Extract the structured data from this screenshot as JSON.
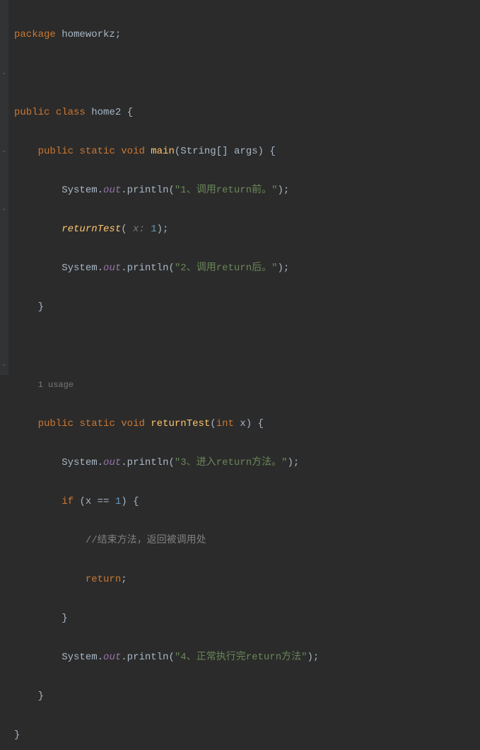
{
  "code": {
    "package_kw": "package",
    "package_name": "homeworkz",
    "public_kw": "public",
    "class_kw": "class",
    "static_kw": "static",
    "void_kw": "void",
    "int_kw": "int",
    "if_kw": "if",
    "return_kw": "return",
    "class_name": "home2",
    "main_method": "main",
    "returnTest_method": "returnTest",
    "string_type": "String",
    "args_param": "args",
    "x_param": "x",
    "system": "System",
    "out_field": "out",
    "println": "println",
    "param_hint_x": " x: ",
    "arg_1": "1",
    "eq_1": "1",
    "str1": "\"1、调用return前。\"",
    "str2": "\"2、调用return后。\"",
    "str3": "\"3、进入return方法。\"",
    "str4": "\"4、正常执行完return方法\"",
    "comment1": "//结束方法，返回被调用处",
    "usage_label": "1 usage"
  }
}
